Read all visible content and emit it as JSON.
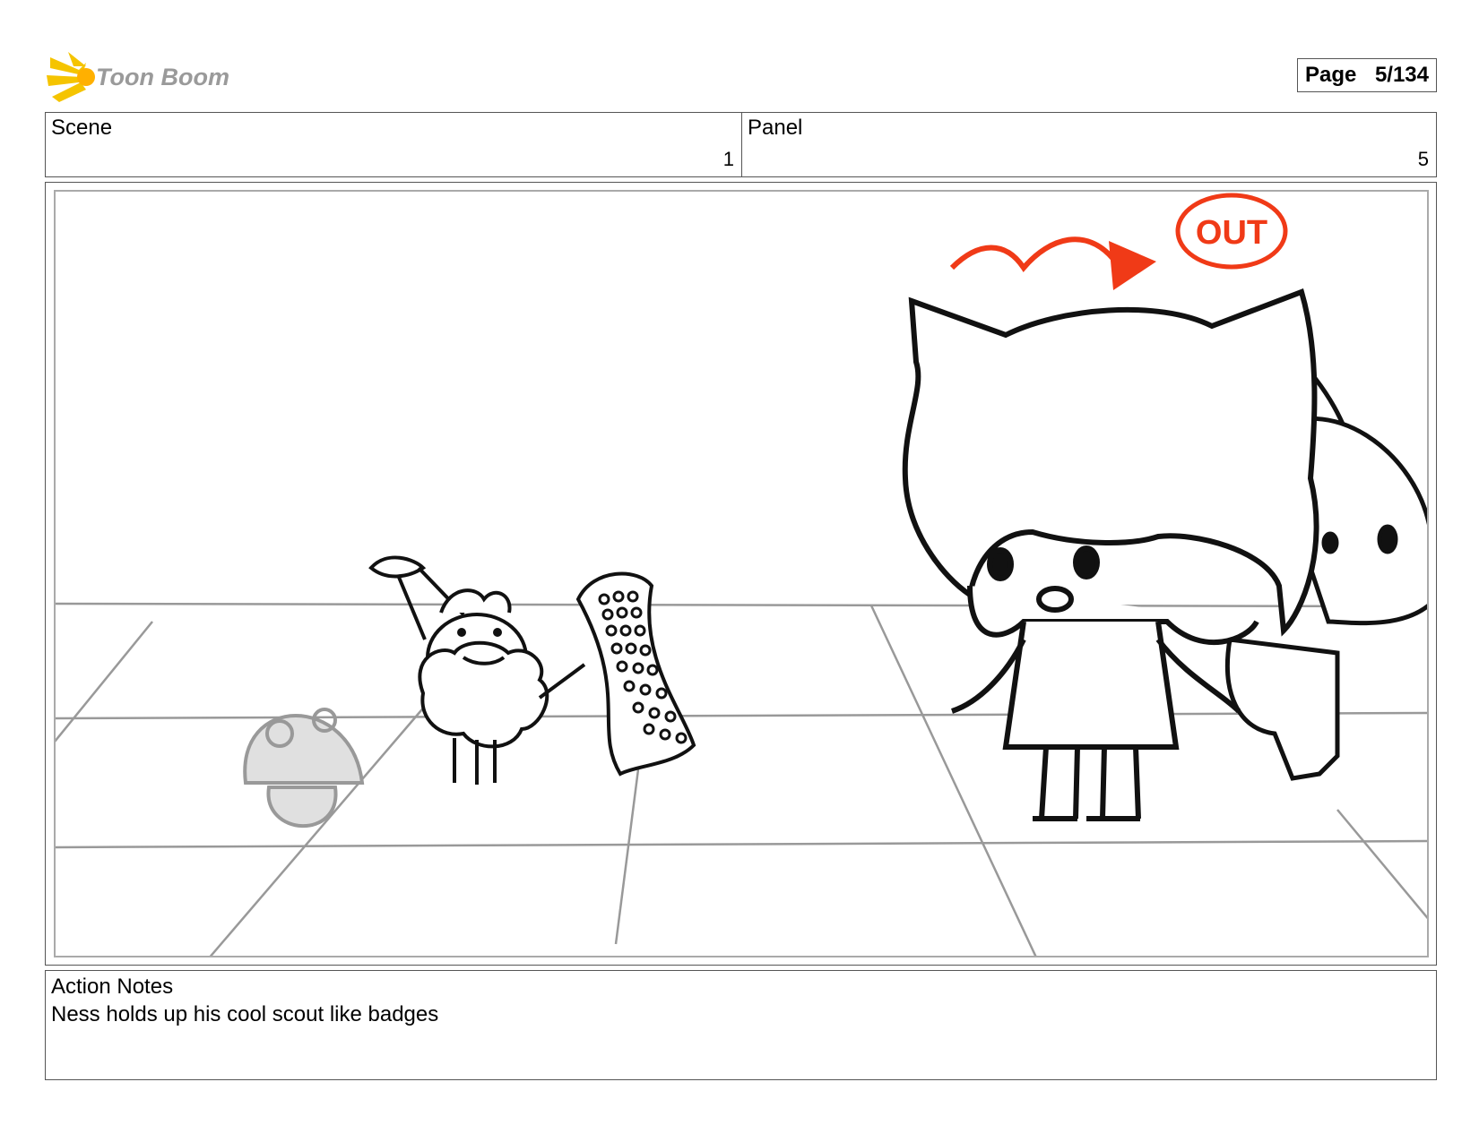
{
  "logo": {
    "text": "Toon Boom",
    "text_color": "#999999",
    "burst_color": "#f5c400"
  },
  "page": {
    "label": "Page",
    "number": "5/134"
  },
  "header": {
    "scene": {
      "label": "Scene",
      "value": "1"
    },
    "panel": {
      "label": "Panel",
      "value": "5"
    }
  },
  "drawing": {
    "annotation_text": "OUT",
    "annotation_color": "#f03a17",
    "floor_line_color": "#999999",
    "ink_color": "#111111",
    "mushroom_fill": "#e0e0e0"
  },
  "notes": {
    "label": "Action Notes",
    "text": "Ness holds up his cool scout like badges"
  }
}
